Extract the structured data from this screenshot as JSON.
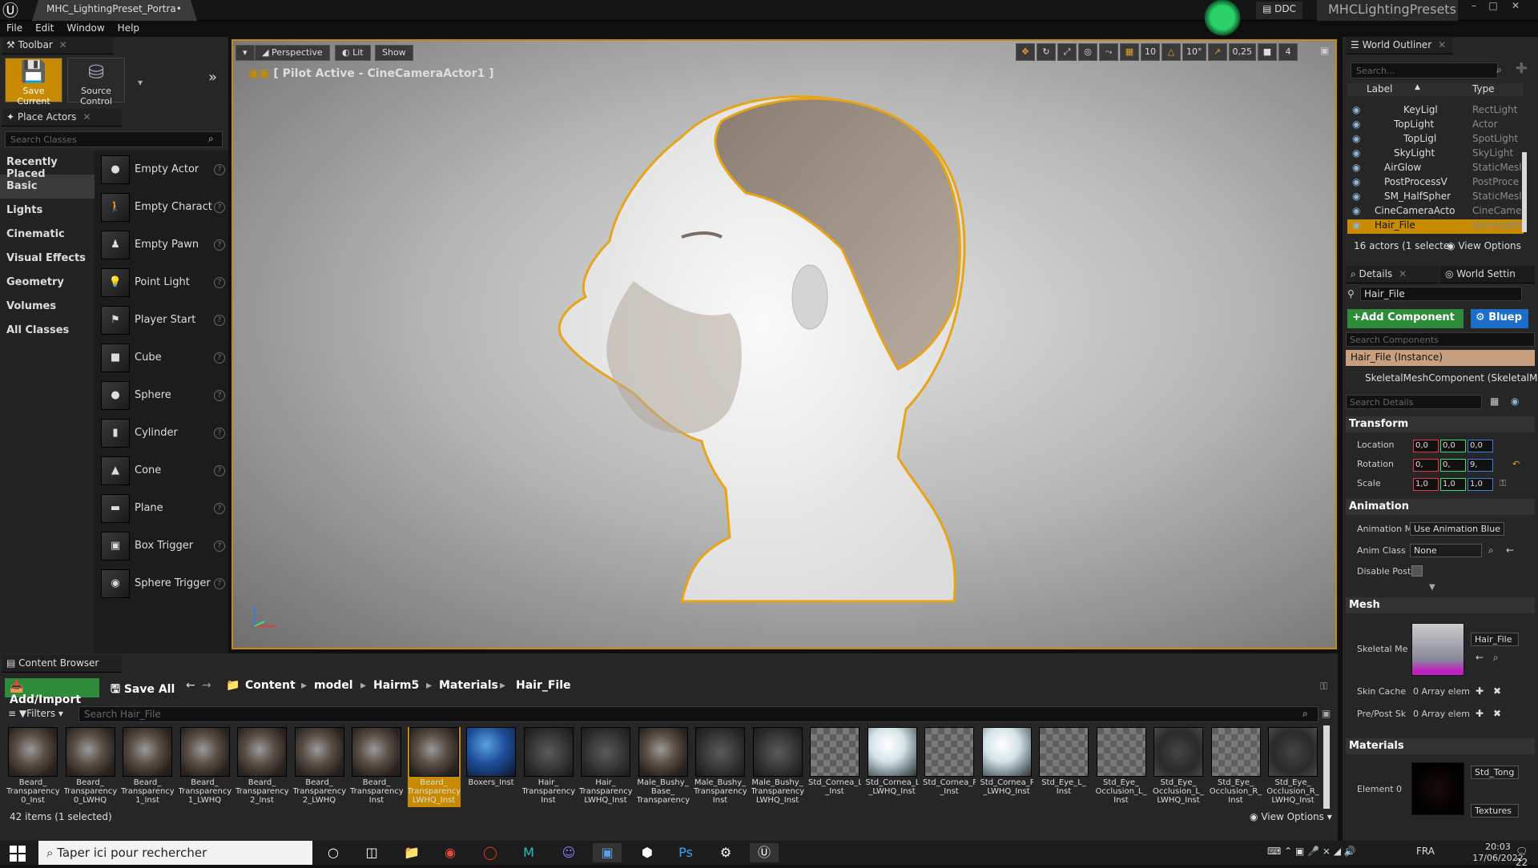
{
  "titlebar": {
    "tab": "MHC_LightingPreset_Portra•",
    "ddc": "DDC",
    "project": "MHCLightingPresets"
  },
  "menu": [
    "File",
    "Edit",
    "Window",
    "Help"
  ],
  "toolbar": {
    "title": "Toolbar",
    "save_current": "Save Current",
    "source_control": "Source Control"
  },
  "place_actors": {
    "title": "Place Actors",
    "search_placeholder": "Search Classes",
    "categories": [
      "Recently Placed",
      "Basic",
      "Lights",
      "Cinematic",
      "Visual Effects",
      "Geometry",
      "Volumes",
      "All Classes"
    ],
    "items": [
      "Empty Actor",
      "Empty Charact",
      "Empty Pawn",
      "Point Light",
      "Player Start",
      "Cube",
      "Sphere",
      "Cylinder",
      "Cone",
      "Plane",
      "Box Trigger",
      "Sphere Trigger"
    ]
  },
  "viewport": {
    "perspective": "Perspective",
    "lit": "Lit",
    "show": "Show",
    "pilot_label": "[ Pilot Active - CineCameraActor1 ]",
    "grid_snap": "10",
    "rot_snap": "10°",
    "scale_snap": "0,25",
    "cam_speed": "4"
  },
  "world_outliner": {
    "title": "World Outliner",
    "search_placeholder": "Search...",
    "col_label": "Label",
    "col_type": "Type",
    "rows": [
      {
        "label": "KeyLigl",
        "type": "RectLight",
        "indent": 3
      },
      {
        "label": "TopLight",
        "type": "Actor",
        "indent": 2
      },
      {
        "label": "TopLigl",
        "type": "SpotLight",
        "indent": 3
      },
      {
        "label": "SkyLight",
        "type": "SkyLight",
        "indent": 2
      },
      {
        "label": "AirGlow",
        "type": "StaticMesl",
        "indent": 1
      },
      {
        "label": "PostProcessV",
        "type": "PostProce",
        "indent": 1
      },
      {
        "label": "SM_HalfSpher",
        "type": "StaticMesl",
        "indent": 1
      },
      {
        "label": "CineCameraActo",
        "type": "CineCame",
        "indent": 0
      },
      {
        "label": "Hair_File",
        "type": "SkeletalMe",
        "indent": 0
      }
    ],
    "status": "16 actors (1 selecte",
    "view_options": "View Options"
  },
  "details": {
    "tab_details": "Details",
    "tab_world": "World Settin",
    "name": "Hair_File",
    "add_component": "+Add Component",
    "blueprint": "Bluep",
    "search_components": "Search Components",
    "instance": "Hair_File (Instance)",
    "component": "SkeletalMeshComponent (SkeletalMe",
    "search_details": "Search Details",
    "transform": "Transform",
    "location": "Location",
    "rotation": "Rotation",
    "scale": "Scale",
    "loc_vals": [
      "0,0",
      "0,0",
      "0,0"
    ],
    "rot_vals": [
      "0,",
      "0,",
      "9,"
    ],
    "scale_vals": [
      "1,0",
      "1,0",
      "1,0"
    ],
    "animation": "Animation",
    "anim_mode_label": "Animation M",
    "anim_mode_value": "Use Animation Blue",
    "anim_class_label": "Anim Class",
    "anim_class_value": "None",
    "disable_post": "Disable Post",
    "mesh": "Mesh",
    "skeletal_mesh_label": "Skeletal Me",
    "skeletal_mesh_value": "Hair_File",
    "skin_cache": "Skin Cache",
    "pre_post": "Pre/Post Sk",
    "array_elements": "0 Array elem",
    "materials": "Materials",
    "element0": "Element 0",
    "material_value": "Std_Tong",
    "textures": "Textures"
  },
  "content_browser": {
    "title": "Content Browser",
    "add_import": "Add/Import",
    "save_all": "Save All",
    "path": [
      "Content",
      "model",
      "Hairm5",
      "Materials",
      "Hair_File"
    ],
    "filters": "Filters",
    "search_placeholder": "Search Hair_File",
    "assets": [
      {
        "name": "Beard_ Transparency 0_Inst",
        "kind": "hair"
      },
      {
        "name": "Beard_ Transparency 0_LWHQ",
        "kind": "hair"
      },
      {
        "name": "Beard_ Transparency 1_Inst",
        "kind": "hair"
      },
      {
        "name": "Beard_ Transparency 1_LWHQ",
        "kind": "hair"
      },
      {
        "name": "Beard_ Transparency 2_Inst",
        "kind": "hair"
      },
      {
        "name": "Beard_ Transparency 2_LWHQ",
        "kind": "hair"
      },
      {
        "name": "Beard_ Transparency Inst",
        "kind": "hair"
      },
      {
        "name": "Beard_ Transparency LWHQ_Inst",
        "kind": "hair",
        "selected": true
      },
      {
        "name": "Boxers_Inst",
        "kind": "blue"
      },
      {
        "name": "Hair_ Transparency Inst",
        "kind": "dark"
      },
      {
        "name": "Hair_ Transparency LWHQ_Inst",
        "kind": "dark"
      },
      {
        "name": "Male_Bushy_ Base_ Transparency",
        "kind": "hair"
      },
      {
        "name": "Male_Bushy_ Transparency Inst",
        "kind": "dark"
      },
      {
        "name": "Male_Bushy_ Transparency LWHQ_Inst",
        "kind": "dark"
      },
      {
        "name": "Std_Cornea_L _Inst",
        "kind": "check"
      },
      {
        "name": "Std_Cornea_L _LWHQ_Inst",
        "kind": "white"
      },
      {
        "name": "Std_Cornea_R _Inst",
        "kind": "check"
      },
      {
        "name": "Std_Cornea_R _LWHQ_Inst",
        "kind": "white"
      },
      {
        "name": "Std_Eye_L_ Inst",
        "kind": "check"
      },
      {
        "name": "Std_Eye_ Occlusion_L_ Inst",
        "kind": "check"
      },
      {
        "name": "Std_Eye_ Occlusion_L_ LWHQ_Inst",
        "kind": "eye"
      },
      {
        "name": "Std_Eye_ Occlusion_R_ Inst",
        "kind": "check"
      },
      {
        "name": "Std_Eye_ Occlusion_R_ LWHQ_Inst",
        "kind": "eye"
      }
    ],
    "count": "42 items (1 selected)",
    "view_options": "View Options"
  },
  "taskbar": {
    "search_placeholder": "Taper ici pour rechercher",
    "lang": "FRA",
    "time": "20:03",
    "date": "17/06/2022",
    "notif": "22"
  }
}
